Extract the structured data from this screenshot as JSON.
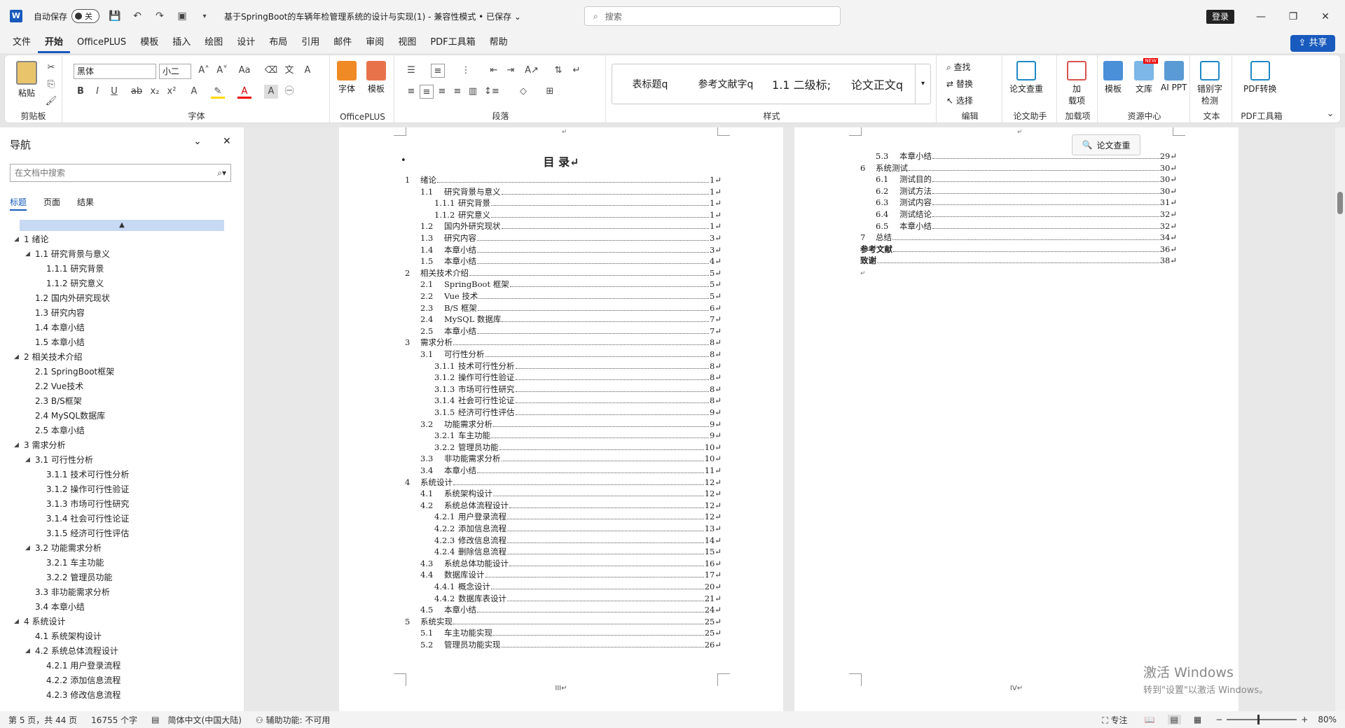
{
  "titlebar": {
    "autosave_label": "自动保存",
    "autosave_state": "关",
    "doc_title": "基于SpringBoot的车辆年检管理系统的设计与实现(1)  -  兼容性模式 • 已保存 ⌄",
    "search_placeholder": "搜索",
    "login_label": "登录"
  },
  "menu": {
    "tabs": [
      "文件",
      "开始",
      "OfficePLUS",
      "模板",
      "插入",
      "绘图",
      "设计",
      "布局",
      "引用",
      "邮件",
      "审阅",
      "视图",
      "PDF工具箱",
      "帮助"
    ],
    "active": "开始",
    "share_label": "共享"
  },
  "ribbon": {
    "clipboard": {
      "paste": "粘贴",
      "label": "剪贴板"
    },
    "font": {
      "name": "黑体",
      "size": "小二",
      "label": "字体"
    },
    "officeplus": {
      "font_btn": "字体",
      "template_btn": "模板",
      "label": "OfficePLUS"
    },
    "paragraph": {
      "label": "段落"
    },
    "styles": {
      "items": [
        "表标题q",
        "参考文献字q",
        "1.1  二级标;",
        "论文正文q"
      ],
      "label": "样式"
    },
    "edit": {
      "find": "查找",
      "replace": "替换",
      "select": "选择",
      "label": "编辑"
    },
    "paper_helper": {
      "btn": "论文查重",
      "label": "论文助手"
    },
    "addins": {
      "btn": "加\n载项",
      "label": "加载项"
    },
    "resources": {
      "template": "模板",
      "library": "文库",
      "ai_ppt": "AI PPT",
      "new_badge": "NEW",
      "label": "资源中心"
    },
    "text": {
      "btn": "错别字\n检测",
      "label": "文本"
    },
    "pdf": {
      "btn": "PDF转换",
      "label": "PDF工具箱"
    }
  },
  "nav": {
    "title": "导航",
    "search_placeholder": "在文档中搜索",
    "tabs": [
      "标题",
      "页面",
      "结果"
    ],
    "active_tab": "标题",
    "items": [
      {
        "text": "1 绪论",
        "level": 0,
        "arrow": true
      },
      {
        "text": "1.1 研究背景与意义",
        "level": 1,
        "arrow": true
      },
      {
        "text": "1.1.1 研究背景",
        "level": 2,
        "arrow": false
      },
      {
        "text": "1.1.2 研究意义",
        "level": 2,
        "arrow": false
      },
      {
        "text": "1.2 国内外研究现状",
        "level": 1,
        "arrow": false
      },
      {
        "text": "1.3 研究内容",
        "level": 1,
        "arrow": false
      },
      {
        "text": "1.4 本章小结",
        "level": 1,
        "arrow": false
      },
      {
        "text": "1.5 本章小结",
        "level": 1,
        "arrow": false
      },
      {
        "text": "2 相关技术介绍",
        "level": 0,
        "arrow": true
      },
      {
        "text": "2.1 SpringBoot框架",
        "level": 1,
        "arrow": false
      },
      {
        "text": "2.2 Vue技术",
        "level": 1,
        "arrow": false
      },
      {
        "text": "2.3 B/S框架",
        "level": 1,
        "arrow": false
      },
      {
        "text": "2.4 MySQL数据库",
        "level": 1,
        "arrow": false
      },
      {
        "text": "2.5 本章小结",
        "level": 1,
        "arrow": false
      },
      {
        "text": "3 需求分析",
        "level": 0,
        "arrow": true
      },
      {
        "text": "3.1 可行性分析",
        "level": 1,
        "arrow": true
      },
      {
        "text": "3.1.1 技术可行性分析",
        "level": 2,
        "arrow": false
      },
      {
        "text": "3.1.2 操作可行性验证",
        "level": 2,
        "arrow": false
      },
      {
        "text": "3.1.3 市场可行性研究",
        "level": 2,
        "arrow": false
      },
      {
        "text": "3.1.4 社会可行性论证",
        "level": 2,
        "arrow": false
      },
      {
        "text": "3.1.5 经济可行性评估",
        "level": 2,
        "arrow": false
      },
      {
        "text": "3.2 功能需求分析",
        "level": 1,
        "arrow": true
      },
      {
        "text": "3.2.1 车主功能",
        "level": 2,
        "arrow": false
      },
      {
        "text": "3.2.2 管理员功能",
        "level": 2,
        "arrow": false
      },
      {
        "text": "3.3 非功能需求分析",
        "level": 1,
        "arrow": false
      },
      {
        "text": "3.4 本章小结",
        "level": 1,
        "arrow": false
      },
      {
        "text": "4 系统设计",
        "level": 0,
        "arrow": true
      },
      {
        "text": "4.1 系统架构设计",
        "level": 1,
        "arrow": false
      },
      {
        "text": "4.2 系统总体流程设计",
        "level": 1,
        "arrow": true
      },
      {
        "text": "4.2.1 用户登录流程",
        "level": 2,
        "arrow": false
      },
      {
        "text": "4.2.2 添加信息流程",
        "level": 2,
        "arrow": false
      },
      {
        "text": "4.2.3 修改信息流程",
        "level": 2,
        "arrow": false
      }
    ]
  },
  "page3": {
    "title": "目  录↵",
    "bullet": "•",
    "footer": "III↵",
    "top_mark": "↵",
    "toc": [
      {
        "num": "1",
        "title": "绪论",
        "page": "1↵",
        "level": 0
      },
      {
        "num": "1.1",
        "title": "研究背景与意义",
        "page": "1↵",
        "level": 1
      },
      {
        "num": "1.1.1",
        "title": "研究背景",
        "page": "1↵",
        "level": 2
      },
      {
        "num": "1.1.2",
        "title": "研究意义",
        "page": "1↵",
        "level": 2
      },
      {
        "num": "1.2",
        "title": "国内外研究现状",
        "page": "1↵",
        "level": 1
      },
      {
        "num": "1.3",
        "title": "研究内容",
        "page": "3↵",
        "level": 1
      },
      {
        "num": "1.4",
        "title": "本章小结",
        "page": "3↵",
        "level": 1
      },
      {
        "num": "1.5",
        "title": "本章小结",
        "page": "4↵",
        "level": 1
      },
      {
        "num": "2",
        "title": "相关技术介绍",
        "page": "5↵",
        "level": 0
      },
      {
        "num": "2.1",
        "title": "SpringBoot 框架",
        "page": "5↵",
        "level": 1
      },
      {
        "num": "2.2",
        "title": "Vue 技术",
        "page": "5↵",
        "level": 1
      },
      {
        "num": "2.3",
        "title": "B/S 框架",
        "page": "6↵",
        "level": 1
      },
      {
        "num": "2.4",
        "title": "MySQL 数据库",
        "page": "7↵",
        "level": 1
      },
      {
        "num": "2.5",
        "title": "本章小结",
        "page": "7↵",
        "level": 1
      },
      {
        "num": "3",
        "title": "需求分析",
        "page": "8↵",
        "level": 0
      },
      {
        "num": "3.1",
        "title": "可行性分析",
        "page": "8↵",
        "level": 1
      },
      {
        "num": "3.1.1",
        "title": "技术可行性分析",
        "page": "8↵",
        "level": 2
      },
      {
        "num": "3.1.2",
        "title": "操作可行性验证",
        "page": "8↵",
        "level": 2
      },
      {
        "num": "3.1.3",
        "title": "市场可行性研究",
        "page": "8↵",
        "level": 2
      },
      {
        "num": "3.1.4",
        "title": "社会可行性论证",
        "page": "8↵",
        "level": 2
      },
      {
        "num": "3.1.5",
        "title": "经济可行性评估",
        "page": "9↵",
        "level": 2
      },
      {
        "num": "3.2",
        "title": "功能需求分析",
        "page": "9↵",
        "level": 1
      },
      {
        "num": "3.2.1",
        "title": "车主功能",
        "page": "9↵",
        "level": 2
      },
      {
        "num": "3.2.2",
        "title": "管理员功能",
        "page": "10↵",
        "level": 2
      },
      {
        "num": "3.3",
        "title": "非功能需求分析",
        "page": "10↵",
        "level": 1
      },
      {
        "num": "3.4",
        "title": "本章小结",
        "page": "11↵",
        "level": 1
      },
      {
        "num": "4",
        "title": "系统设计",
        "page": "12↵",
        "level": 0
      },
      {
        "num": "4.1",
        "title": "系统架构设计",
        "page": "12↵",
        "level": 1
      },
      {
        "num": "4.2",
        "title": "系统总体流程设计",
        "page": "12↵",
        "level": 1
      },
      {
        "num": "4.2.1",
        "title": "用户登录流程",
        "page": "12↵",
        "level": 2
      },
      {
        "num": "4.2.2",
        "title": "添加信息流程",
        "page": "13↵",
        "level": 2
      },
      {
        "num": "4.2.3",
        "title": "修改信息流程",
        "page": "14↵",
        "level": 2
      },
      {
        "num": "4.2.4",
        "title": "删除信息流程",
        "page": "15↵",
        "level": 2
      },
      {
        "num": "4.3",
        "title": "系统总体功能设计",
        "page": "16↵",
        "level": 1
      },
      {
        "num": "4.4",
        "title": "数据库设计",
        "page": "17↵",
        "level": 1
      },
      {
        "num": "4.4.1",
        "title": "概念设计",
        "page": "20↵",
        "level": 2
      },
      {
        "num": "4.4.2",
        "title": "数据库表设计",
        "page": "21↵",
        "level": 2
      },
      {
        "num": "4.5",
        "title": "本章小结",
        "page": "24↵",
        "level": 1
      },
      {
        "num": "5",
        "title": "系统实现",
        "page": "25↵",
        "level": 0
      },
      {
        "num": "5.1",
        "title": "车主功能实现",
        "page": "25↵",
        "level": 1
      },
      {
        "num": "5.2",
        "title": "管理员功能实现",
        "page": "26↵",
        "level": 1
      }
    ]
  },
  "page4": {
    "footer": "IV↵",
    "top_mark": "↵",
    "end_mark": "↵",
    "float_button": "论文查重",
    "toc": [
      {
        "num": "5.3",
        "title": "本章小结",
        "page": "29↵",
        "level": 1
      },
      {
        "num": "6",
        "title": "系统测试",
        "page": "30↵",
        "level": 0
      },
      {
        "num": "6.1",
        "title": "测试目的",
        "page": "30↵",
        "level": 1
      },
      {
        "num": "6.2",
        "title": "测试方法",
        "page": "30↵",
        "level": 1
      },
      {
        "num": "6.3",
        "title": "测试内容",
        "page": "31↵",
        "level": 1
      },
      {
        "num": "6.4",
        "title": "测试结论",
        "page": "32↵",
        "level": 1
      },
      {
        "num": "6.5",
        "title": "本章小结",
        "page": "32↵",
        "level": 1
      },
      {
        "num": "7",
        "title": "总结",
        "page": "34↵",
        "level": 0
      },
      {
        "num": "",
        "title": "参考文献",
        "page": "36↵",
        "level": -1
      },
      {
        "num": "",
        "title": "致谢",
        "page": "38↵",
        "level": -1
      }
    ]
  },
  "watermark": {
    "line1": "激活 Windows",
    "line2": "转到\"设置\"以激活 Windows。"
  },
  "status": {
    "page": "第 5 页，共 44 页",
    "words": "16755 个字",
    "lang": "简体中文(中国大陆)",
    "accessibility": "辅助功能: 不可用",
    "focus": "专注",
    "zoom": "80%"
  }
}
